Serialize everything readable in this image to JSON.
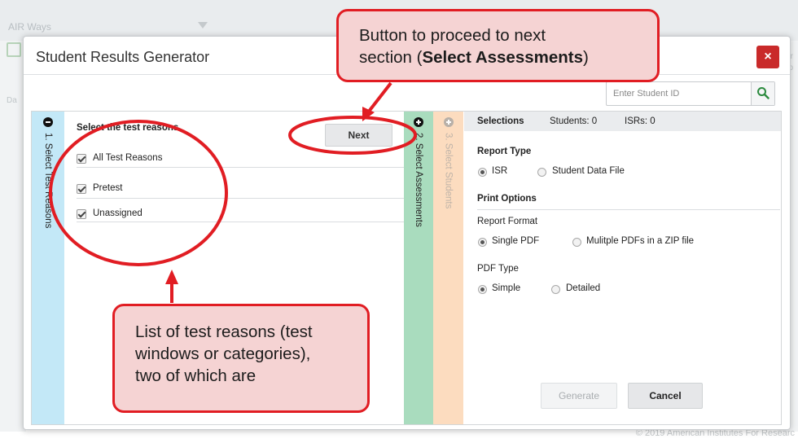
{
  "background": {
    "app_label": "AIR Ways",
    "left_letters": [
      "Da"
    ],
    "right_letters": [
      "Tr",
      "o"
    ],
    "footer": "© 2019 American Institutes For Researc"
  },
  "modal": {
    "title": "Student Results Generator",
    "close_label": "×",
    "search": {
      "placeholder": "Enter Student ID",
      "value": ""
    }
  },
  "tabs": {
    "tab1": {
      "label": "1. Select Test Reasons",
      "icon": "minus-circle-icon"
    },
    "tab2": {
      "label": "2. Select Assessments",
      "icon": "plus-circle-icon"
    },
    "tab3": {
      "label": "3. Select Students",
      "icon": "plus-circle-icon"
    }
  },
  "reasons_panel": {
    "title": "Select the test reasons.",
    "next_label": "Next",
    "items": [
      {
        "label": "All Test Reasons",
        "checked": true
      },
      {
        "label": "Pretest",
        "checked": true
      },
      {
        "label": "Unassigned",
        "checked": true
      }
    ]
  },
  "selections": {
    "title": "Selections",
    "students": "Students: 0",
    "isrs": "ISRs: 0",
    "report_type": {
      "heading": "Report Type",
      "options": [
        {
          "label": "ISR",
          "selected": true
        },
        {
          "label": "Student Data File",
          "selected": false
        }
      ]
    },
    "print_options": {
      "heading": "Print Options",
      "report_format": {
        "label": "Report Format",
        "options": [
          {
            "label": "Single PDF",
            "selected": true
          },
          {
            "label": "Mulitple PDFs in a ZIP file",
            "selected": false
          }
        ]
      },
      "pdf_type": {
        "label": "PDF Type",
        "options": [
          {
            "label": "Simple",
            "selected": true
          },
          {
            "label": "Detailed",
            "selected": false
          }
        ]
      }
    },
    "generate_label": "Generate",
    "cancel_label": "Cancel"
  },
  "callouts": {
    "top_line1": "Button to proceed to next",
    "top_line2_prefix": "section (",
    "top_line2_bold": "Select Assessments",
    "top_line2_suffix": ")",
    "bottom_line1": "List of test reasons (test",
    "bottom_line2": "windows or categories),",
    "bottom_line3": "two of which are"
  },
  "colors": {
    "tab1": "#c3e8f7",
    "tab2": "#a9dcbe",
    "tab3": "#fcdcbf",
    "close": "#c92a2a",
    "callout_border": "#e11d23",
    "callout_fill": "#f5d3d3"
  }
}
